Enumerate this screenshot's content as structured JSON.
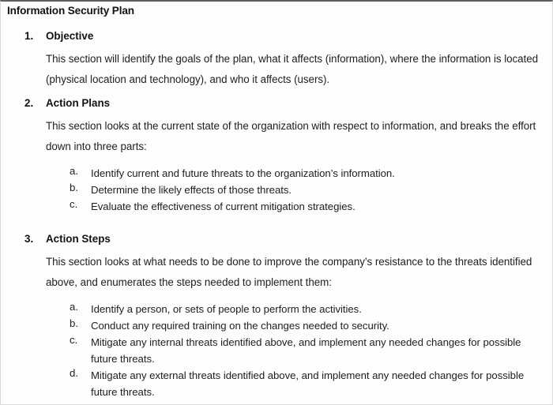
{
  "document": {
    "title": "Information Security Plan",
    "sections": [
      {
        "number": "1.",
        "heading": "Objective",
        "body": "This section will identify the goals of the plan, what it affects (information), where the information is located (physical location and technology), and who it affects (users).",
        "subitems": []
      },
      {
        "number": "2.",
        "heading": "Action Plans",
        "body": "This section looks at the current state of the organization with respect to information, and breaks the effort down into three parts:",
        "subitems": [
          {
            "marker": "a.",
            "text": "Identify current and future threats to the organization’s information."
          },
          {
            "marker": "b.",
            "text": "Determine the likely effects of those threats."
          },
          {
            "marker": "c.",
            "text": "Evaluate the effectiveness of current mitigation strategies."
          }
        ]
      },
      {
        "number": "3.",
        "heading": "Action Steps",
        "body": "This section looks at what needs to be done to improve the company’s resistance to the threats identified above, and enumerates the steps needed to implement them:",
        "subitems": [
          {
            "marker": "a.",
            "text": "Identify a person, or sets of people to perform the activities."
          },
          {
            "marker": "b.",
            "text": "Conduct any required training on the changes needed to security."
          },
          {
            "marker": "c.",
            "text": "Mitigate any internal threats identified above, and implement any needed changes for possible future threats."
          },
          {
            "marker": "d.",
            "text": "Mitigate any external threats identified above, and implement any needed changes for possible future threats."
          }
        ]
      }
    ]
  },
  "style": {
    "page_background": "#fdfdfd",
    "text_color": "#212121",
    "heading_color": "#131313",
    "border_top_color": "#5d5d5d",
    "border_side_color": "#d8d8d8"
  }
}
